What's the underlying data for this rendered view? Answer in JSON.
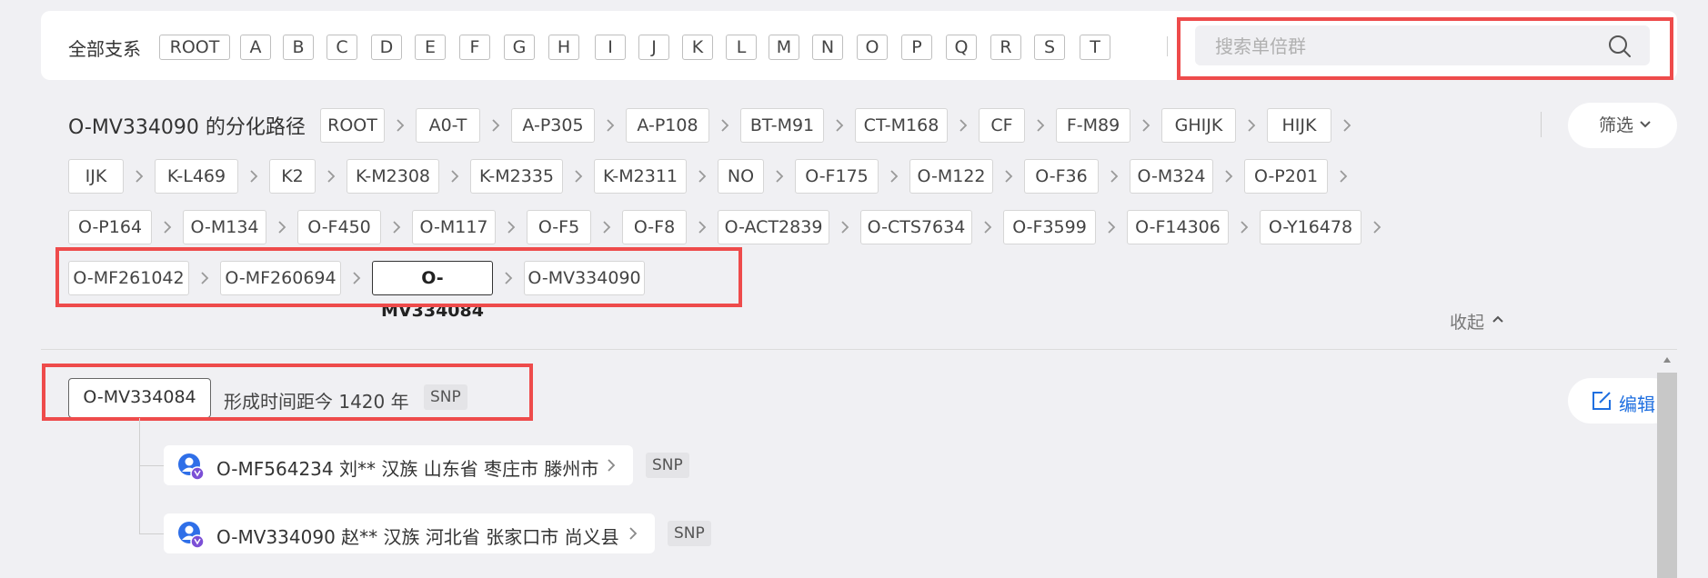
{
  "branch_filter": {
    "label": "全部支系",
    "chips": [
      "ROOT",
      "A",
      "B",
      "C",
      "D",
      "E",
      "F",
      "G",
      "H",
      "I",
      "J",
      "K",
      "L",
      "M",
      "N",
      "O",
      "P",
      "Q",
      "R",
      "S",
      "T"
    ]
  },
  "search": {
    "placeholder": "搜索单倍群",
    "value": ""
  },
  "path": {
    "title": "O-MV334090 的分化路径",
    "rows": [
      [
        "ROOT",
        "A0-T",
        "A-P305",
        "A-P108",
        "BT-M91",
        "CT-M168",
        "CF",
        "F-M89",
        "GHIJK",
        "HIJK"
      ],
      [
        "IJK",
        "K-L469",
        "K2",
        "K-M2308",
        "K-M2335",
        "K-M2311",
        "NO",
        "O-F175",
        "O-M122",
        "O-F36",
        "O-M324",
        "O-P201"
      ],
      [
        "O-P164",
        "O-M134",
        "O-F450",
        "O-M117",
        "O-F5",
        "O-F8",
        "O-ACT2839",
        "O-CTS7634",
        "O-F3599",
        "O-F14306",
        "O-Y16478"
      ],
      [
        "O-MF261042",
        "O-MF260694",
        "O-MV334084",
        "O-MV334090"
      ]
    ],
    "active": "O-MV334084"
  },
  "filter_button": {
    "label": "筛选",
    "icon": "chevron-down-icon"
  },
  "collapse": {
    "label": "收起",
    "icon": "chevron-up-icon"
  },
  "detail": {
    "haplogroup": "O-MV334084",
    "formation": "形成时间距今 1420 年",
    "tag": "SNP",
    "edit_label": "编辑",
    "children": [
      {
        "label": "O-MF564234 刘** 汉族 山东省 枣庄市 滕州市",
        "tag": "SNP",
        "icon": "user-avatar-icon"
      },
      {
        "label": "O-MV334090 赵** 汉族 河北省 张家口市 尚义县",
        "tag": "SNP",
        "icon": "user-avatar-icon"
      }
    ]
  },
  "colors": {
    "highlight": "#ee4b4b",
    "accent": "#1f6fe0",
    "badge": "#7b4fd6",
    "avatar": "#2f6fe8"
  }
}
